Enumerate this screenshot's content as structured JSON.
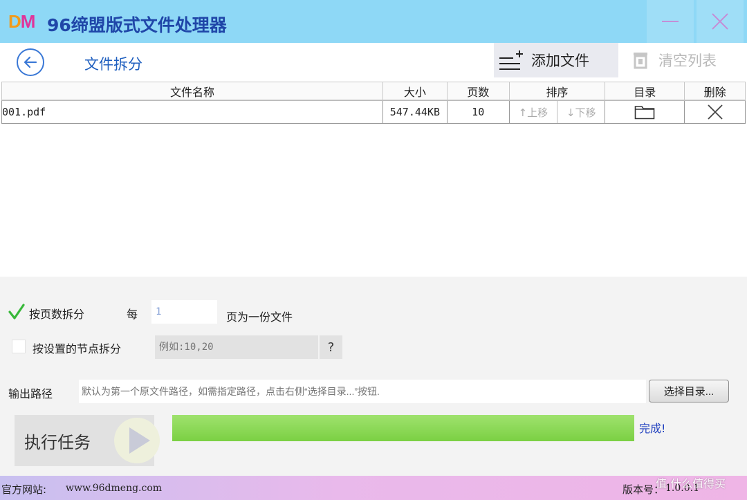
{
  "window": {
    "logo_d": "D",
    "logo_m": "M",
    "title": "96缔盟版式文件处理器",
    "minimize_icon": "minimize-icon",
    "close_icon": "close-icon",
    "accent_color": "#8ed8f6"
  },
  "toolbar": {
    "back_icon": "arrow-left-circle-icon",
    "page_title": "文件拆分",
    "add_file_label": "添加文件",
    "clear_list_label": "清空列表"
  },
  "table": {
    "columns": [
      "文件名称",
      "大小",
      "页数",
      "排序",
      "目录",
      "删除"
    ],
    "rows": [
      {
        "name": "001.pdf",
        "size": "547.44KB",
        "pages": "10",
        "move_up": "↑上移",
        "move_down": "↓下移",
        "dir_icon": "folder-icon",
        "delete_icon": "delete-x-icon"
      }
    ]
  },
  "options": {
    "split_by_pages_label": "按页数拆分",
    "split_by_pages_checked": true,
    "every_label": "每",
    "pages_value": "1",
    "pages_suffix": "页为一份文件",
    "split_by_nodes_label": "按设置的节点拆分",
    "split_by_nodes_checked": false,
    "nodes_placeholder": "例如:10,20",
    "help_label": "?"
  },
  "output": {
    "label": "输出路径",
    "placeholder": "默认为第一个原文件路径，如需指定路径，点击右侧“选择目录...”按钮.",
    "browse_label": "选择目录..."
  },
  "run": {
    "label": "执行任务",
    "progress_fraction": 1.0,
    "status": "完成!"
  },
  "footer": {
    "site_label": "官方网站:",
    "site_url": "www.96dmeng.com",
    "version_label": "版本号：",
    "version_value": "1.0.0.1"
  },
  "watermark": "值 什么值得买"
}
